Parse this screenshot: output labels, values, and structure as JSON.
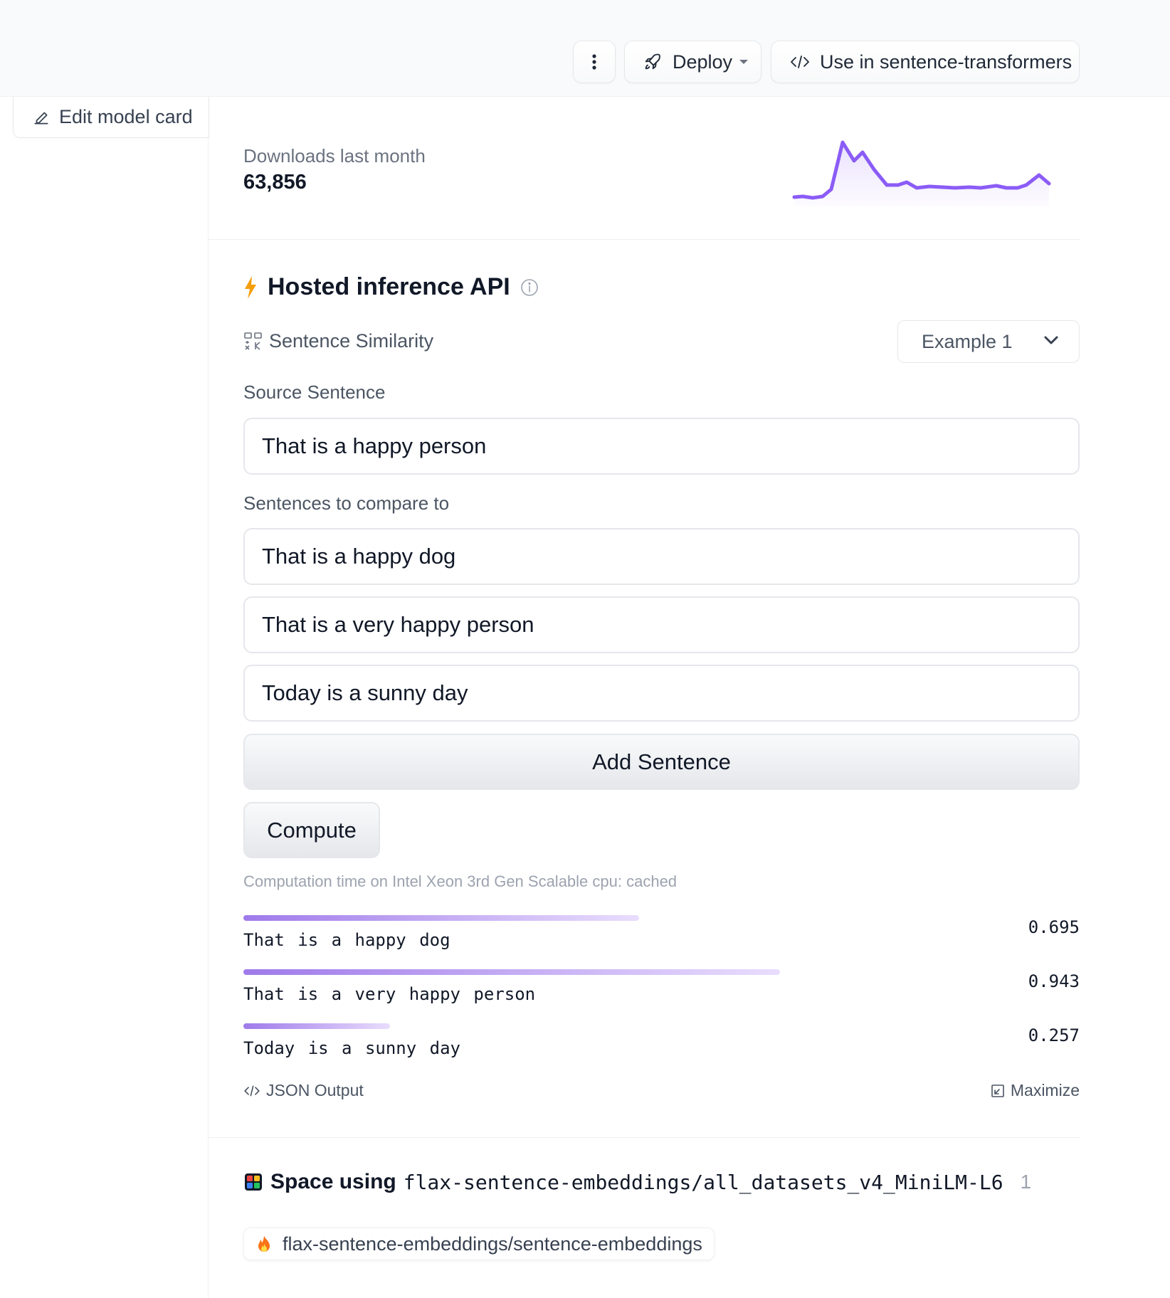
{
  "header": {
    "deploy_label": "Deploy",
    "use_in_label": "Use in sentence-transformers"
  },
  "sidebar": {
    "edit_model_card_label": "Edit model card"
  },
  "downloads": {
    "label": "Downloads last month",
    "value": "63,856"
  },
  "inference": {
    "title": "Hosted inference API",
    "task_label": "Sentence Similarity",
    "example_selected": "Example 1",
    "source_label": "Source Sentence",
    "source_value": "That is a happy person",
    "compare_label": "Sentences to compare to",
    "compare_values": [
      "That is a happy dog",
      "That is a very happy person",
      "Today is a sunny day"
    ],
    "add_sentence_label": "Add Sentence",
    "compute_label": "Compute",
    "computation_time": "Computation time on Intel Xeon 3rd Gen Scalable cpu: cached",
    "results": [
      {
        "text": "That is a happy dog",
        "score": "0.695",
        "fraction": 0.695
      },
      {
        "text": "That is a very happy person",
        "score": "0.943",
        "fraction": 0.943
      },
      {
        "text": "Today is a sunny day",
        "score": "0.257",
        "fraction": 0.257
      }
    ],
    "json_output_label": "JSON Output",
    "maximize_label": "Maximize"
  },
  "spaces": {
    "prefix": "Space using",
    "model_id": "flax-sentence-embeddings/all_datasets_v4_MiniLM-L6",
    "count": "1",
    "items": [
      {
        "name": "flax-sentence-embeddings/sentence-embeddings"
      }
    ]
  },
  "colors": {
    "accent": "#8b5cf6",
    "bolt": "#f59e0b"
  }
}
